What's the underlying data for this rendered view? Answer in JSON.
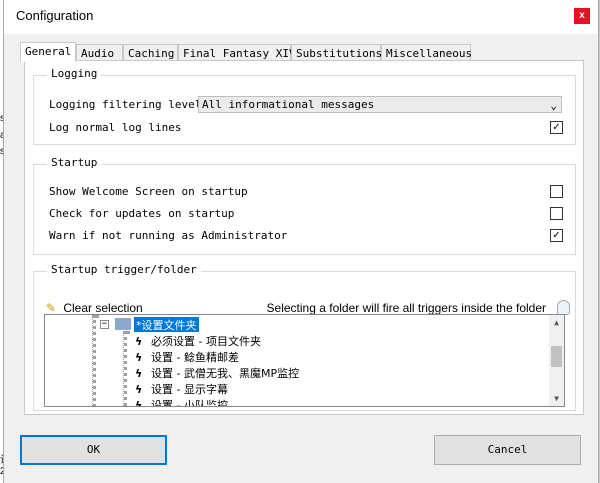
{
  "background_fragments": [
    "s",
    "ac",
    "s",
    "设2"
  ],
  "window": {
    "title": "Configuration",
    "close_glyph": "x"
  },
  "tabs": [
    {
      "label": "General",
      "active": true
    },
    {
      "label": "Audio",
      "active": false
    },
    {
      "label": "Caching",
      "active": false
    },
    {
      "label": "Final Fantasy XIV",
      "active": false
    },
    {
      "label": "Substitutions",
      "active": false
    },
    {
      "label": "Miscellaneous",
      "active": false
    }
  ],
  "logging": {
    "title": "Logging",
    "filter_label": "Logging filtering level",
    "filter_value": "All informational messages",
    "normal_lines_label": "Log normal log lines",
    "normal_lines_checked": true
  },
  "startup": {
    "title": "Startup",
    "welcome_label": "Show Welcome Screen on startup",
    "welcome_checked": false,
    "updates_label": "Check for updates on startup",
    "updates_checked": false,
    "admin_label": "Warn if not running as Administrator",
    "admin_checked": true
  },
  "trigger_folder": {
    "title": "Startup trigger/folder",
    "clear_label": "Clear selection",
    "info_text": "Selecting a folder will fire all triggers inside the folder",
    "tree": {
      "root": "*设置文件夹",
      "expander": "−",
      "bolt_glyph": "ϟ",
      "children": [
        "必须设置 - 项目文件夹",
        "设置 - 鲶鱼精邮差",
        "设置 - 武僧无我、黑魔MP监控",
        "设置 - 显示字幕",
        "设置 - 小队监控"
      ]
    }
  },
  "buttons": {
    "ok": "OK",
    "cancel": "Cancel"
  },
  "glyphs": {
    "check": "✓",
    "chevron": "⌄",
    "scroll_up": "▲",
    "scroll_down": "▼",
    "broom": "✎"
  },
  "colors": {
    "selection": "#0078d7",
    "close": "#e81123"
  }
}
